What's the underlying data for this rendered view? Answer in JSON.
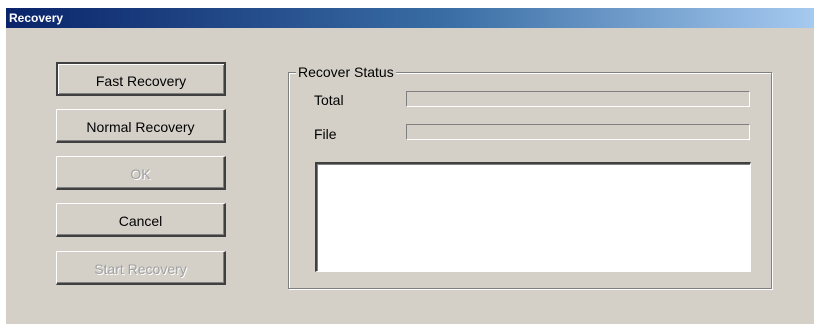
{
  "window": {
    "title": "Recovery"
  },
  "buttons": {
    "fast_recovery": "Fast Recovery",
    "normal_recovery": "Normal Recovery",
    "ok": "OK",
    "cancel": "Cancel",
    "start_recovery": "Start Recovery"
  },
  "status": {
    "group_label": "Recover Status",
    "total_label": "Total",
    "total_progress": 0,
    "file_label": "File",
    "file_progress": 0,
    "log_text": ""
  },
  "colors": {
    "face": "#d4d0c8",
    "title_start": "#0a246a",
    "title_end": "#a6caf0"
  }
}
